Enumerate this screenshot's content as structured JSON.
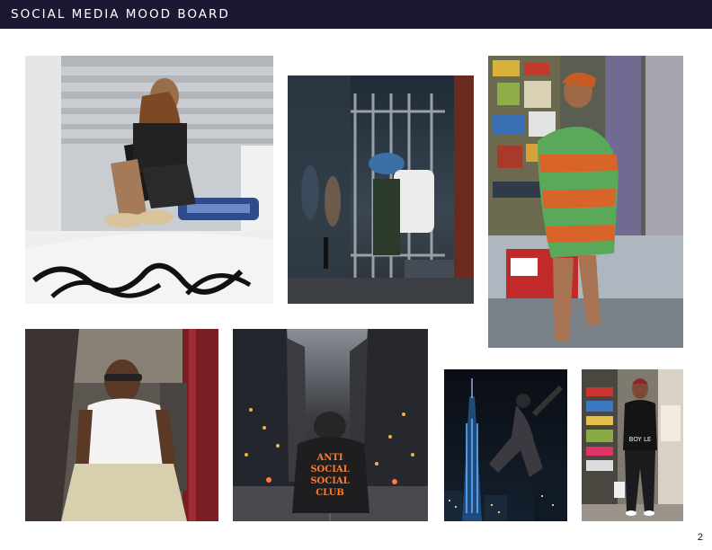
{
  "header": {
    "title": "SOCIAL MEDIA MOOD BOARD",
    "background": "#1c1733"
  },
  "footer": {
    "page_number": "2"
  },
  "photos": [
    {
      "id": "rooftop-car",
      "overlay_text": ""
    },
    {
      "id": "fenced-street",
      "overlay_text": ""
    },
    {
      "id": "striped-sweater-store",
      "overlay_text": ""
    },
    {
      "id": "car-door-seated",
      "overlay_text": ""
    },
    {
      "id": "city-street-hoodie",
      "overlay_lines": [
        "ANTI",
        "SOCIAL",
        "SOCIAL",
        "CLUB"
      ]
    },
    {
      "id": "skyline-jump",
      "overlay_text": ""
    },
    {
      "id": "shop-doorway",
      "overlay_text": "BOY LE"
    }
  ]
}
